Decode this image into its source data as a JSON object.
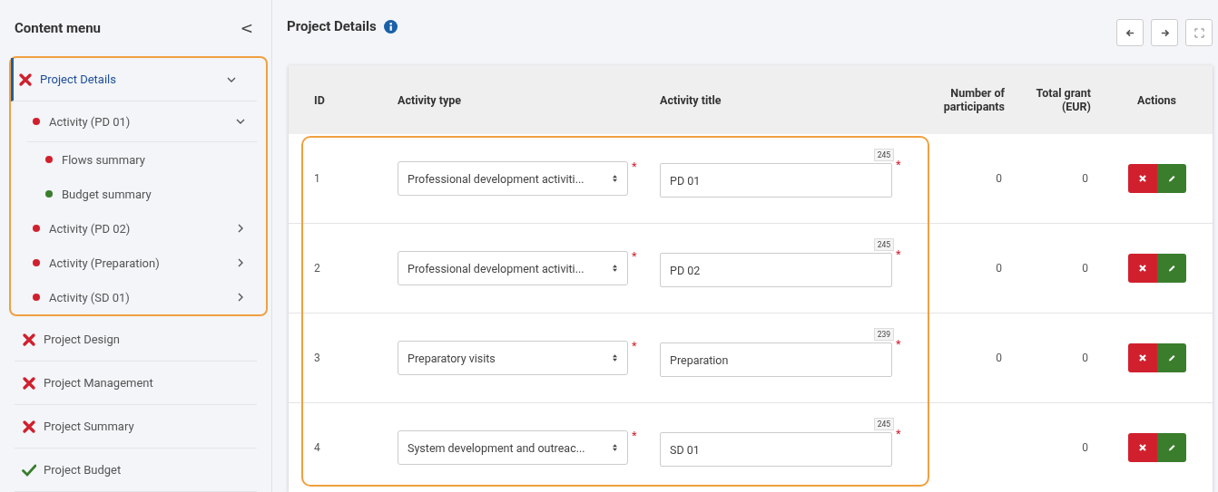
{
  "sidebar": {
    "title": "Content menu",
    "collapse_icon": "<",
    "items": [
      {
        "label": "Project Details",
        "kind": "error",
        "selected": true,
        "expanded": true,
        "highlighted": true,
        "children": [
          {
            "label": "Activity (PD 01)",
            "color": "#d0202e",
            "expanded": true,
            "children": [
              {
                "label": "Flows summary",
                "color": "#d0202e"
              },
              {
                "label": "Budget summary",
                "color": "#3a7d2c"
              }
            ]
          },
          {
            "label": "Activity (PD 02)",
            "color": "#d0202e",
            "expanded": false
          },
          {
            "label": "Activity (Preparation)",
            "color": "#d0202e",
            "expanded": false
          },
          {
            "label": "Activity (SD 01)",
            "color": "#d0202e",
            "expanded": false
          }
        ]
      },
      {
        "label": "Project Design",
        "kind": "error",
        "selected": false,
        "highlighted": false
      },
      {
        "label": "Project Management",
        "kind": "error",
        "selected": false,
        "highlighted": false
      },
      {
        "label": "Project Summary",
        "kind": "error",
        "selected": false,
        "highlighted": false
      },
      {
        "label": "Project Budget",
        "kind": "ok",
        "selected": false,
        "highlighted": false
      }
    ]
  },
  "page": {
    "title": "Project Details"
  },
  "table": {
    "highlighted": true,
    "columns": [
      "ID",
      "Activity type",
      "Activity title",
      "Number of participants",
      "Total grant (EUR)",
      "Actions"
    ],
    "rows": [
      {
        "id": "1",
        "type": "Professional development activiti...",
        "type_required": "*",
        "title": "PD 01",
        "counter": "245",
        "title_required": "*",
        "participants": "0",
        "grant": "0"
      },
      {
        "id": "2",
        "type": "Professional development activiti...",
        "type_required": "*",
        "title": "PD 02",
        "counter": "245",
        "title_required": "*",
        "participants": "0",
        "grant": "0"
      },
      {
        "id": "3",
        "type": "Preparatory visits",
        "type_required": "*",
        "title": "Preparation",
        "counter": "239",
        "title_required": "*",
        "participants": "0",
        "grant": "0"
      },
      {
        "id": "4",
        "type": "System development and outreac...",
        "type_required": "*",
        "title": "SD 01",
        "counter": "245",
        "title_required": "*",
        "grant": "0"
      }
    ]
  }
}
